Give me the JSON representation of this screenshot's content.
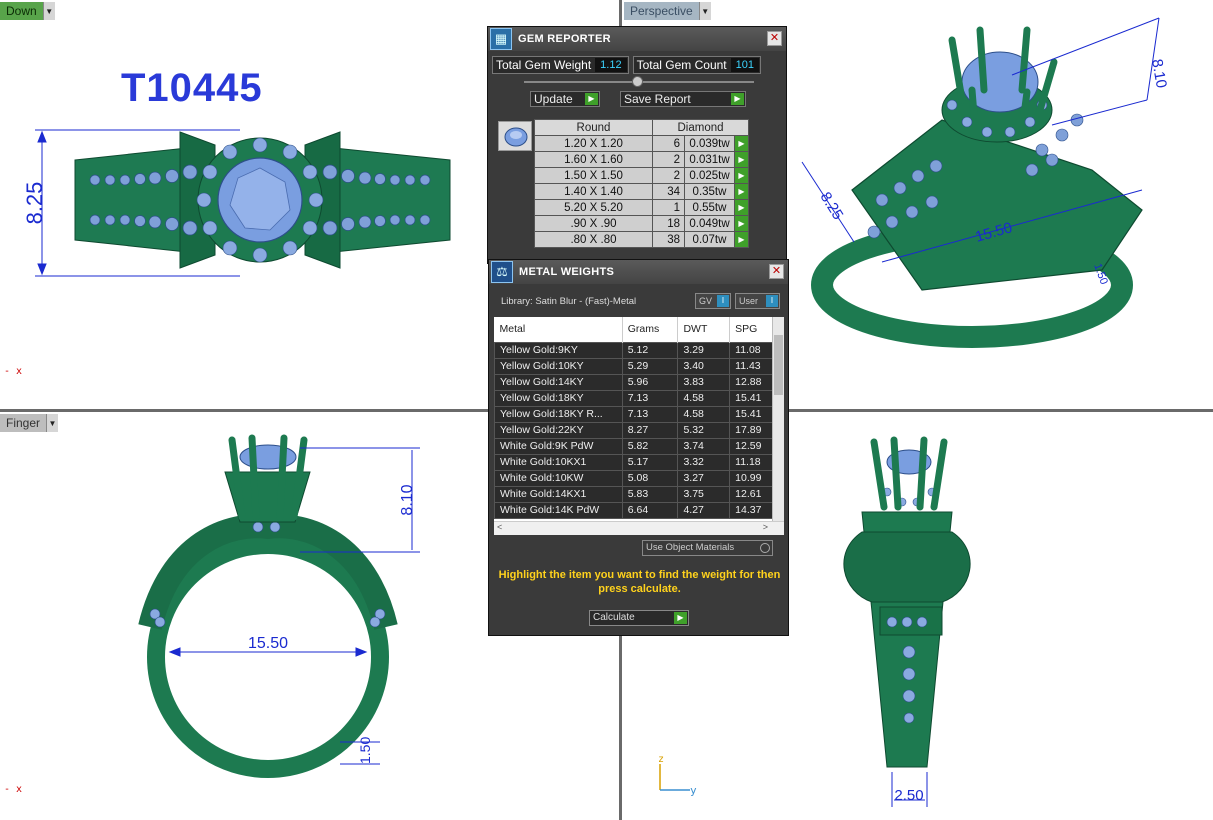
{
  "viewports": {
    "top_left": {
      "tab": "Down"
    },
    "top_right": {
      "tab": "Perspective"
    },
    "bottom_left": {
      "tab": "Finger"
    }
  },
  "model_id": "T10445",
  "dimensions": {
    "top_height": "8.25",
    "persp_height": "8.10",
    "persp_width": "8.25",
    "persp_length": "15.50",
    "persp_band": "1.50",
    "front_height": "8.10",
    "front_diameter": "15.50",
    "front_band": "1.50",
    "side_width": "2.50"
  },
  "axis": {
    "x": "x",
    "y": "y",
    "z": "z"
  },
  "gem_reporter": {
    "title": "GEM REPORTER",
    "total_weight_label": "Total Gem Weight",
    "total_weight_value": "1.12",
    "total_count_label": "Total Gem Count",
    "total_count_value": "101",
    "update_label": "Update",
    "save_report_label": "Save Report",
    "shape_header": "Round",
    "material_header": "Diamond",
    "rows": [
      {
        "size": "1.20 X 1.20",
        "count": "6",
        "weight": "0.039tw"
      },
      {
        "size": "1.60 X 1.60",
        "count": "2",
        "weight": "0.031tw"
      },
      {
        "size": "1.50 X 1.50",
        "count": "2",
        "weight": "0.025tw"
      },
      {
        "size": "1.40 X 1.40",
        "count": "34",
        "weight": "0.35tw"
      },
      {
        "size": "5.20 X 5.20",
        "count": "1",
        "weight": "0.55tw"
      },
      {
        "size": ".90 X .90",
        "count": "18",
        "weight": "0.049tw"
      },
      {
        "size": ".80 X .80",
        "count": "38",
        "weight": "0.07tw"
      }
    ]
  },
  "metal_weights": {
    "title": "METAL WEIGHTS",
    "library": "Library: Satin Blur - (Fast)-Metal",
    "gv_label": "GV",
    "user_label": "User",
    "columns": [
      "Metal",
      "Grams",
      "DWT",
      "SPG"
    ],
    "rows": [
      [
        "Yellow Gold:9KY",
        "5.12",
        "3.29",
        "11.08"
      ],
      [
        "Yellow Gold:10KY",
        "5.29",
        "3.40",
        "11.43"
      ],
      [
        "Yellow Gold:14KY",
        "5.96",
        "3.83",
        "12.88"
      ],
      [
        "Yellow Gold:18KY",
        "7.13",
        "4.58",
        "15.41"
      ],
      [
        "Yellow Gold:18KY R...",
        "7.13",
        "4.58",
        "15.41"
      ],
      [
        "Yellow Gold:22KY",
        "8.27",
        "5.32",
        "17.89"
      ],
      [
        "White Gold:9K PdW",
        "5.82",
        "3.74",
        "12.59"
      ],
      [
        "White Gold:10KX1",
        "5.17",
        "3.32",
        "11.18"
      ],
      [
        "White Gold:10KW",
        "5.08",
        "3.27",
        "10.99"
      ],
      [
        "White Gold:14KX1",
        "5.83",
        "3.75",
        "12.61"
      ],
      [
        "White Gold:14K PdW",
        "6.64",
        "4.27",
        "14.37"
      ]
    ],
    "use_object_materials": "Use Object Materials",
    "hint": "Highlight the item you want to find the weight for then press calculate.",
    "calculate_label": "Calculate"
  }
}
